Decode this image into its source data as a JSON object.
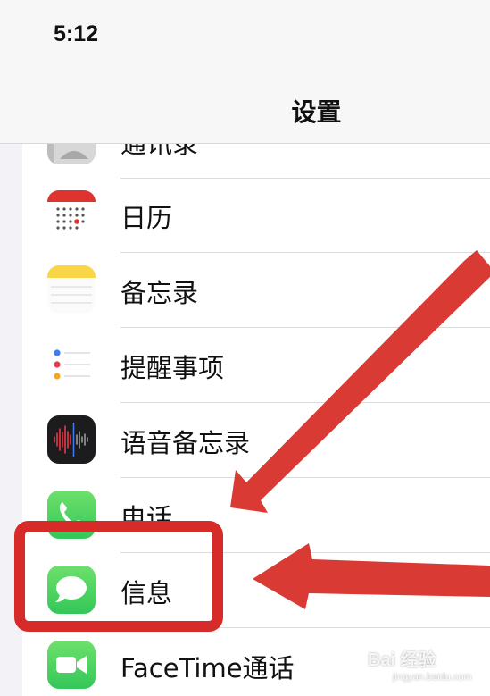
{
  "status_bar": {
    "time": "5:12"
  },
  "nav": {
    "title": "设置"
  },
  "settings_items": [
    {
      "label": "通讯录",
      "icon": "contacts-icon",
      "color": "#bdbdbd"
    },
    {
      "label": "日历",
      "icon": "calendar-icon",
      "color": "#e0322f"
    },
    {
      "label": "备忘录",
      "icon": "notes-icon",
      "color": "#f9d548"
    },
    {
      "label": "提醒事项",
      "icon": "reminders-icon",
      "color": "#3d7cf5"
    },
    {
      "label": "语音备忘录",
      "icon": "voice-memos-icon",
      "color": "#e53b4e"
    },
    {
      "label": "电话",
      "icon": "phone-icon",
      "color": "#5fd35e"
    },
    {
      "label": "信息",
      "icon": "messages-icon",
      "color": "#5fd35e"
    },
    {
      "label": "FaceTime通话",
      "icon": "facetime-icon",
      "color": "#5fd35e"
    }
  ],
  "annotations": {
    "arrow_color": "#d93a34",
    "highlight_color": "#d62b28"
  },
  "watermark": {
    "text": "Bai 经验",
    "sub": "jingyan.baidu.com"
  }
}
